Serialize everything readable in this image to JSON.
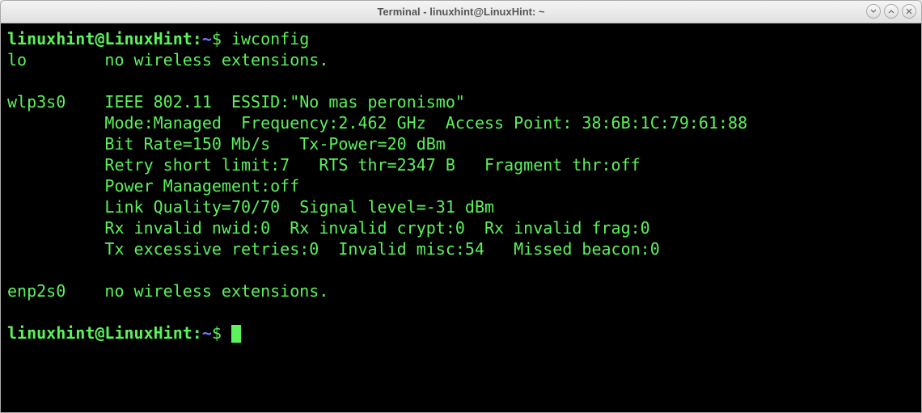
{
  "window": {
    "title": "Terminal - linuxhint@LinuxHint: ~"
  },
  "prompt": {
    "user_host": "linuxhint@LinuxHint",
    "separator": ":",
    "path": "~",
    "sign": "$"
  },
  "command": "iwconfig",
  "output": {
    "lines": [
      "lo        no wireless extensions.",
      "",
      "wlp3s0    IEEE 802.11  ESSID:\"No mas peronismo\"",
      "          Mode:Managed  Frequency:2.462 GHz  Access Point: 38:6B:1C:79:61:88",
      "          Bit Rate=150 Mb/s   Tx-Power=20 dBm",
      "          Retry short limit:7   RTS thr=2347 B   Fragment thr:off",
      "          Power Management:off",
      "          Link Quality=70/70  Signal level=-31 dBm",
      "          Rx invalid nwid:0  Rx invalid crypt:0  Rx invalid frag:0",
      "          Tx excessive retries:0  Invalid misc:54   Missed beacon:0",
      "",
      "enp2s0    no wireless extensions.",
      ""
    ]
  }
}
